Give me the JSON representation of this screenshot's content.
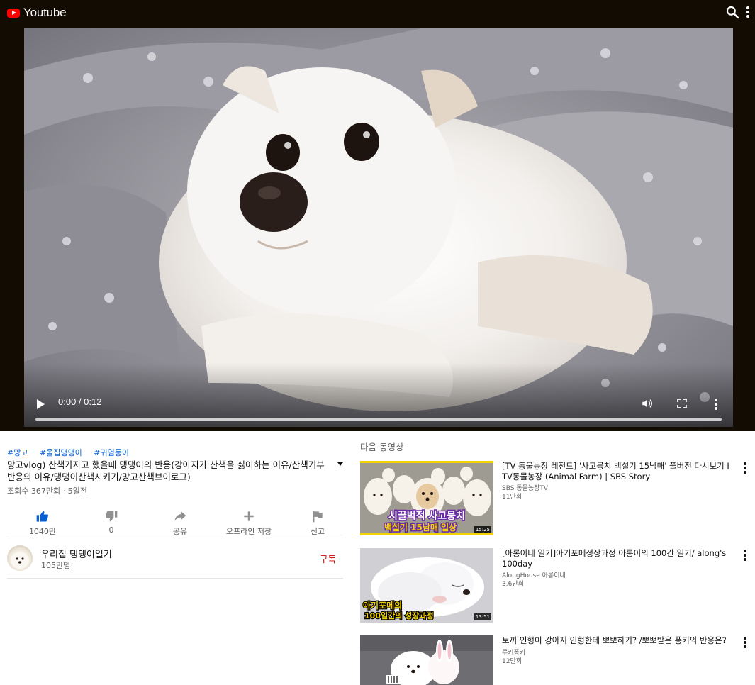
{
  "header": {
    "app_title": "Youtube"
  },
  "player": {
    "time": "0:00 / 0:12"
  },
  "video": {
    "tags": [
      "#망고",
      "#울집댕댕이",
      "#귀염둥이"
    ],
    "title": "망고vlog) 산책가자고 했을때 댕댕이의 반응(강아지가 산책을 싫어하는 이유/산책거부반응의 이유/댕댕이산책시키기/망고산책브이로그)",
    "meta": "조회수 367만회 · 5일전",
    "actions": {
      "like": "1040만",
      "dislike": "0",
      "share": "공유",
      "offline": "오프라인 저장",
      "report": "신고"
    }
  },
  "channel": {
    "name": "우리집 댕댕이일기",
    "subs": "105만명",
    "subscribe": "구독"
  },
  "up_next": {
    "label": "다음 동영상",
    "items": [
      {
        "title": "[TV 동물농장 레전드] '사고뭉치 백설기 15남매' 풀버전 다시보기 I TV동물농장 (Animal Farm) | SBS Story",
        "channel": "SBS 동물농장TV",
        "views": "11만회",
        "duration": "15:25",
        "thumb_text_1": "시끌벅적 사고뭉치",
        "thumb_text_2": "백설기 15남매 일상"
      },
      {
        "title": "[아롱이네 일기]아기포메성장과정 아롱이의 100간 일기/ along's 100day",
        "channel": "AlongHouse 아롱이네",
        "views": "3.6만회",
        "duration": "13:51",
        "thumb_text_1": "아기포메의",
        "thumb_text_2": "100일간의 성장과정"
      },
      {
        "title": "토끼 인형이 강아지 인형한테 뽀뽀하기? /뽀뽀받은 퐁키의 반응은?",
        "channel": "루키퐁키",
        "views": "12만회"
      }
    ]
  },
  "colors": {
    "accent_red": "#ff0000",
    "link_blue": "#065fd4",
    "subscribe_red": "#cc0000",
    "topbar_bg": "#130c03"
  }
}
